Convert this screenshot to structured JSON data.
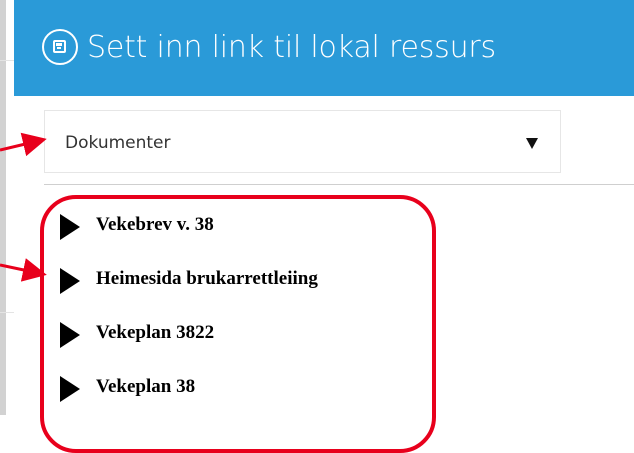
{
  "dialog": {
    "title": "Sett inn link til lokal ressurs",
    "header_color": "#2a9ad8",
    "header_icon": "save-disk-icon"
  },
  "select": {
    "value": "Dokumenter",
    "arrow_icon": "caret-down-icon"
  },
  "tree": {
    "items": [
      {
        "label": "Vekebrev v. 38",
        "icon": "expand-arrow-icon"
      },
      {
        "label": "Heimesida brukarrettleiing",
        "icon": "expand-arrow-icon"
      },
      {
        "label": "Vekeplan 3822",
        "icon": "expand-arrow-icon"
      },
      {
        "label": "Vekeplan 38",
        "icon": "expand-arrow-icon"
      }
    ]
  },
  "annotation": {
    "color": "#e8001c"
  }
}
